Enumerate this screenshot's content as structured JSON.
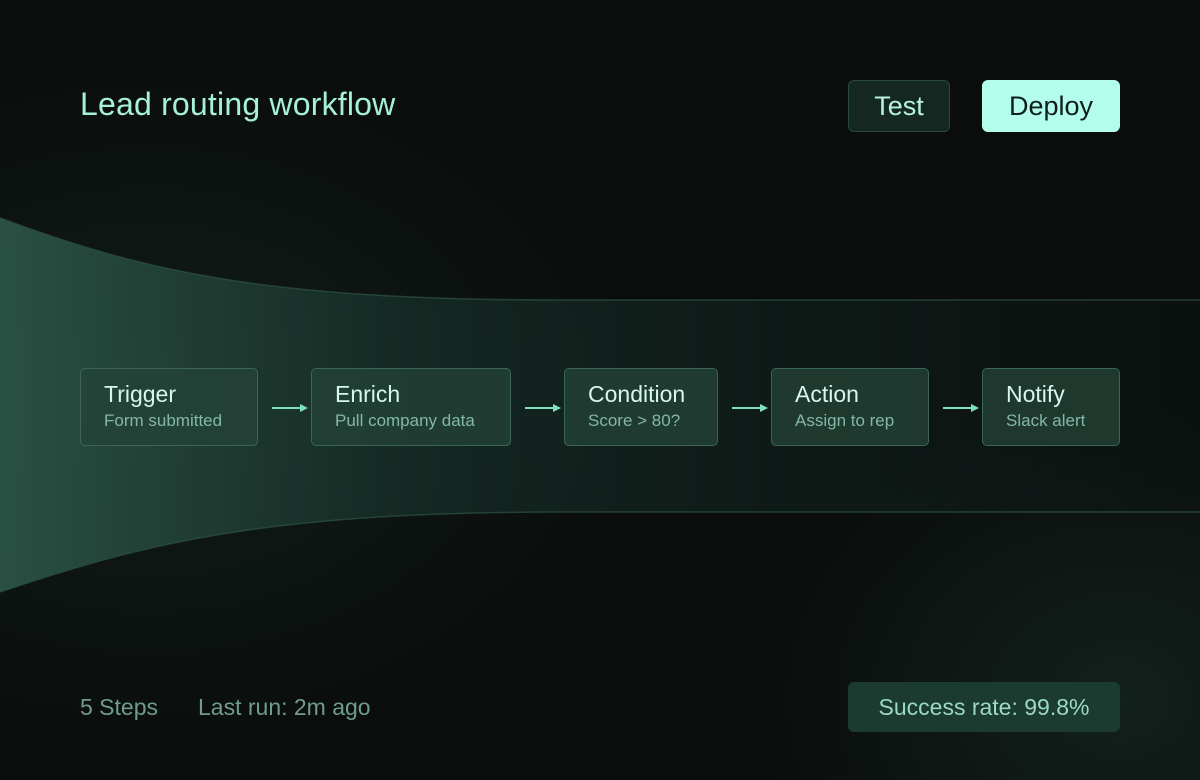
{
  "header": {
    "title": "Lead routing workflow",
    "test_label": "Test",
    "deploy_label": "Deploy"
  },
  "workflow": {
    "steps": [
      {
        "title": "Trigger",
        "subtitle": "Form submitted"
      },
      {
        "title": "Enrich",
        "subtitle": "Pull company data"
      },
      {
        "title": "Condition",
        "subtitle": "Score > 80?"
      },
      {
        "title": "Action",
        "subtitle": "Assign to rep"
      },
      {
        "title": "Notify",
        "subtitle": "Slack alert"
      }
    ]
  },
  "footer": {
    "steps_count": "5 Steps",
    "last_run": "Last run: 2m ago",
    "success_rate": "Success rate: 99.8%"
  },
  "colors": {
    "background": "#0a0d0c",
    "accent": "#b3fdec",
    "title_text": "#a6f0d8",
    "node_fill": "#244237",
    "node_border": "#3b6657"
  },
  "icons": [
    "arrow-right-icon"
  ]
}
